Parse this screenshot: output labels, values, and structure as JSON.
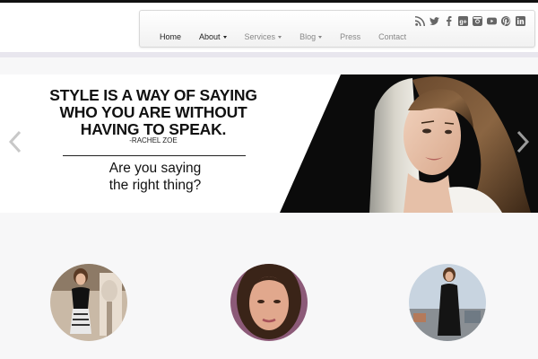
{
  "nav": {
    "items": [
      {
        "label": "Home",
        "dropdown": false,
        "active": true
      },
      {
        "label": "About",
        "dropdown": true,
        "active": true
      },
      {
        "label": "Services",
        "dropdown": true,
        "active": false
      },
      {
        "label": "Blog",
        "dropdown": true,
        "active": false
      },
      {
        "label": "Press",
        "dropdown": false,
        "active": false
      },
      {
        "label": "Contact",
        "dropdown": false,
        "active": false
      }
    ]
  },
  "social_icons": [
    "rss-icon",
    "twitter-icon",
    "facebook-icon",
    "google-plus-icon",
    "instagram-icon",
    "youtube-icon",
    "pinterest-icon",
    "linkedin-icon"
  ],
  "slider": {
    "quote": "STYLE IS A WAY OF SAYING\nWHO YOU ARE WITHOUT\nHAVING TO SPEAK.",
    "author": "-RACHEL ZOE",
    "question": "Are you saying\nthe right thing?"
  },
  "colors": {
    "accent_dark": "#111111",
    "nav_inactive": "#888888",
    "divider": "#e8e6ee"
  }
}
